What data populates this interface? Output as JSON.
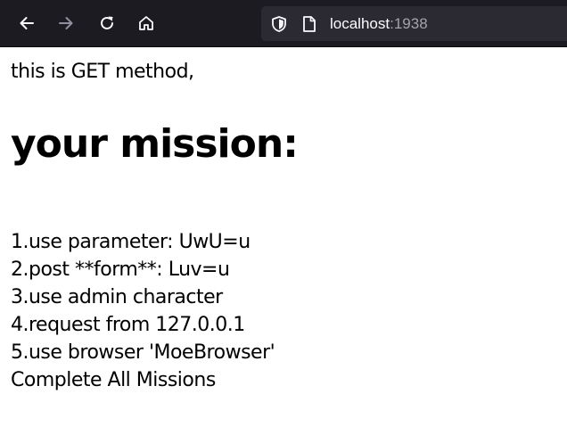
{
  "browser": {
    "url_host": "localhost",
    "url_port": ":1938",
    "icons": [
      "back-arrow-icon",
      "forward-arrow-icon",
      "reload-icon",
      "home-icon",
      "shield-icon",
      "page-icon"
    ]
  },
  "page": {
    "intro": "this is GET method,",
    "heading": "your mission:",
    "missions": [
      "1.use parameter: UwU=u",
      "2.post **form**: Luv=u",
      "3.use admin character",
      "4.request from 127.0.0.1",
      "5.use browser 'MoeBrowser'",
      "Complete All Missions"
    ]
  },
  "colors": {
    "toolbar_bg": "#1c1b22",
    "urlbar_bg": "#2b2a33",
    "icon_active": "#fbfbfe",
    "icon_disabled": "#8f8f9d"
  }
}
